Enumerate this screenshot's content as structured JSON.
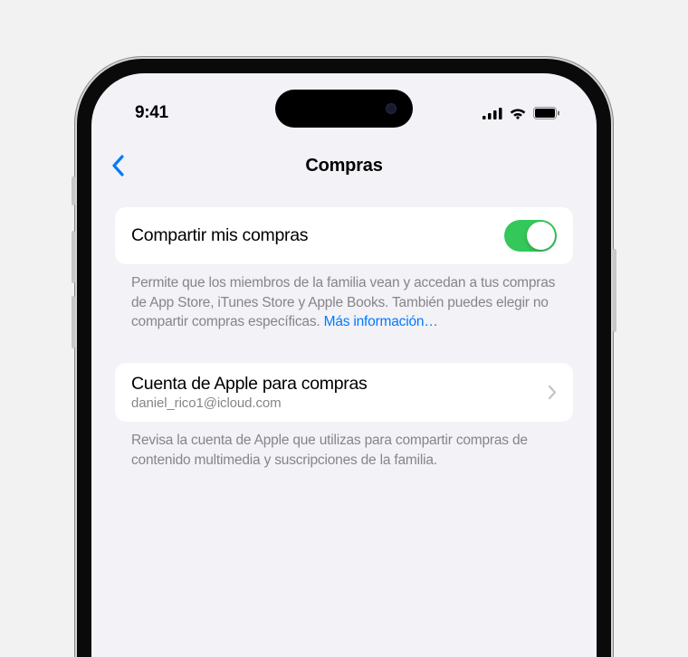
{
  "statusBar": {
    "time": "9:41"
  },
  "nav": {
    "title": "Compras"
  },
  "sharePurchases": {
    "label": "Compartir mis compras",
    "enabled": true,
    "footer": "Permite que los miembros de la familia vean y accedan a tus compras de App Store, iTunes Store y Apple Books. También puedes elegir no compartir compras específicas. ",
    "learnMore": "Más información…"
  },
  "account": {
    "title": "Cuenta de Apple para compras",
    "email": "daniel_rico1@icloud.com",
    "footer": "Revisa la cuenta de Apple que utilizas para compartir compras de contenido multimedia y suscripciones de la familia."
  }
}
